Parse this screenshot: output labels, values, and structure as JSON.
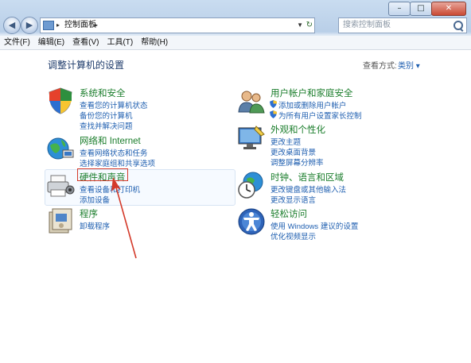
{
  "window": {
    "caption_buttons": {
      "minimize": "–",
      "maximize": "□",
      "close": "✕"
    }
  },
  "address": {
    "back_label": "◀",
    "forward_label": "▶",
    "separator": "▸",
    "crumb": "控制面板",
    "crumb_arrow": "▸",
    "dropdown": "▼",
    "refresh": "↻"
  },
  "search": {
    "placeholder": "搜索控制面板"
  },
  "menu": {
    "file": "文件(F)",
    "edit": "编辑(E)",
    "view": "查看(V)",
    "tools": "工具(T)",
    "help": "帮助(H)"
  },
  "main": {
    "title": "调整计算机的设置",
    "view_by_label": "查看方式:",
    "view_by_value": "类别 ▾"
  },
  "categories": {
    "system": {
      "icon": "shield-icon",
      "heading": "系统和安全",
      "links": [
        "查看您的计算机状态",
        "备份您的计算机",
        "查找并解决问题"
      ]
    },
    "network": {
      "icon": "network-globe-icon",
      "heading": "网络和 Internet",
      "links": [
        "查看网络状态和任务",
        "选择家庭组和共享选项"
      ]
    },
    "hardware": {
      "icon": "printer-speaker-icon",
      "heading": "硬件和声音",
      "links": [
        "查看设备和打印机",
        "添加设备"
      ]
    },
    "programs": {
      "icon": "programs-box-icon",
      "heading": "程序",
      "links": [
        "卸载程序"
      ]
    },
    "users": {
      "icon": "users-icon",
      "heading": "用户帐户和家庭安全",
      "links": [
        "添加或删除用户帐户",
        "为所有用户设置家长控制"
      ]
    },
    "appearance": {
      "icon": "monitor-icon",
      "heading": "外观和个性化",
      "links": [
        "更改主题",
        "更改桌面背景",
        "调整屏幕分辨率"
      ]
    },
    "clock": {
      "icon": "clock-globe-icon",
      "heading": "时钟、语言和区域",
      "links": [
        "更改键盘或其他输入法",
        "更改显示语言"
      ]
    },
    "ease": {
      "icon": "ease-of-access-icon",
      "heading": "轻松访问",
      "links": [
        "使用 Windows 建议的设置",
        "优化视频显示"
      ]
    }
  },
  "colors": {
    "heading_green": "#1a7d2b",
    "link_blue": "#1f5fb0",
    "annotation_red": "#d43a2a"
  }
}
